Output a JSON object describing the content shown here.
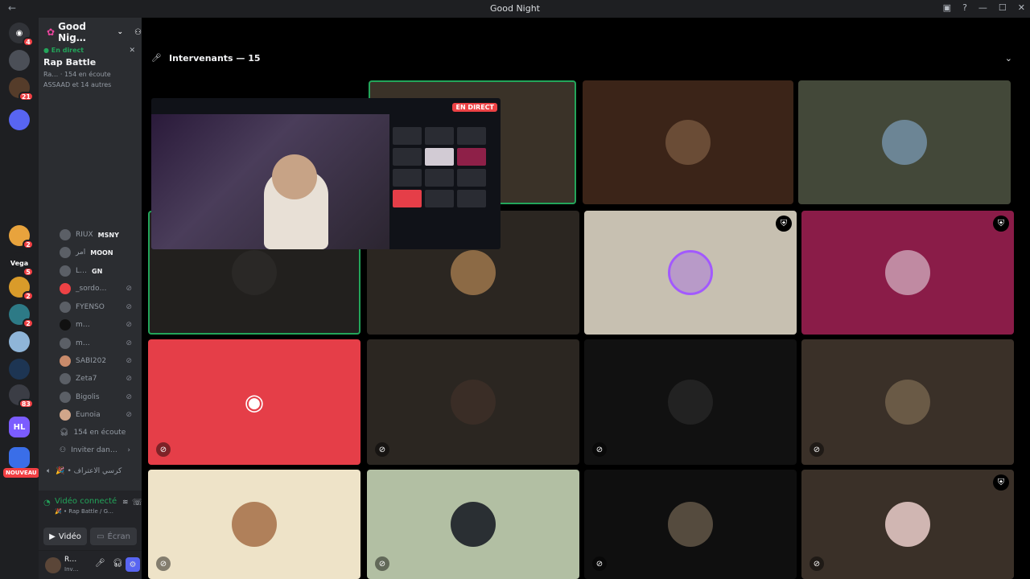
{
  "window": {
    "title": "Good Night",
    "back_icon": "arrow-left-icon",
    "control_icons": [
      "inbox-icon",
      "help-icon",
      "minimize-icon",
      "maximize-icon",
      "close-icon"
    ]
  },
  "servers": {
    "home_badge": "4",
    "badges": [
      "21",
      "2",
      "5",
      "2",
      "2",
      "83"
    ],
    "labels": [
      "Vega",
      "HL"
    ],
    "new_label": "NOUVEAU"
  },
  "guild": {
    "name": "Good Nig…",
    "live_label": "En direct",
    "stage_name": "Rap Battle",
    "listeners_meta": "154 en écoute",
    "stage_meta": "Ra…",
    "others_meta": "ASSAAD et 14 autres"
  },
  "members": [
    {
      "name": "RIUX",
      "tag": "MSNY"
    },
    {
      "name": "امر",
      "tag": "MOON"
    },
    {
      "name": "L…",
      "tag": "GN"
    },
    {
      "name": "_sordo…",
      "tag": ""
    },
    {
      "name": "FYENSO",
      "tag": ""
    },
    {
      "name": "m…",
      "tag": ""
    },
    {
      "name": "m…",
      "tag": ""
    },
    {
      "name": "SABI202",
      "tag": ""
    },
    {
      "name": "Zeta7",
      "tag": ""
    },
    {
      "name": "Bigolis",
      "tag": ""
    },
    {
      "name": "Eunoia",
      "tag": ""
    }
  ],
  "listeners": "154 en écoute",
  "invite": "Inviter dan…",
  "other_channel": "🎉 • كرسي الاعتراف",
  "voice": {
    "status": "Vidéo connecté",
    "sub": "🎉 • Rap Battle / G…",
    "video_btn": "Vidéo",
    "screen_btn": "Écran"
  },
  "user": {
    "name": "R…",
    "status": "Inv…"
  },
  "stage": {
    "speakers_title": "Intervenants — 15"
  },
  "popup": {
    "live": "EN DIRECT"
  },
  "colors": {
    "accent": "#5865f2",
    "live": "#ed4245",
    "speaking": "#23a55a"
  }
}
